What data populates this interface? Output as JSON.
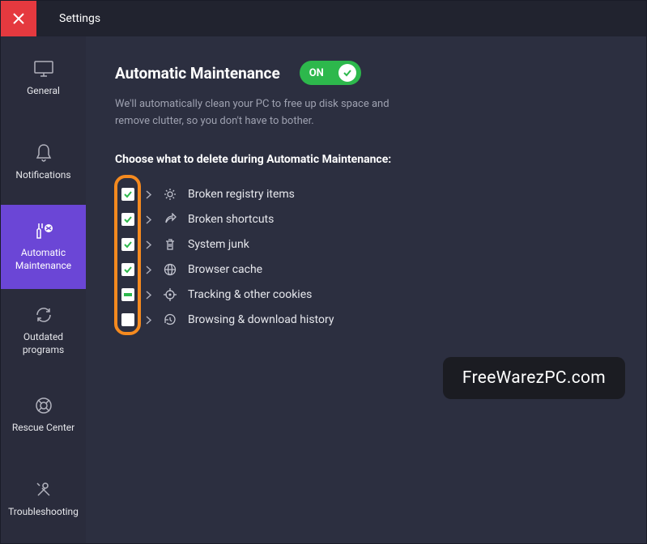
{
  "titlebar": {
    "title": "Settings"
  },
  "sidebar": {
    "items": [
      {
        "label": "General"
      },
      {
        "label": "Notifications"
      },
      {
        "label": "Automatic Maintenance"
      },
      {
        "label": "Outdated programs"
      },
      {
        "label": "Rescue Center"
      },
      {
        "label": "Troubleshooting"
      }
    ]
  },
  "main": {
    "heading": "Automatic Maintenance",
    "toggle_label": "ON",
    "subtext": "We'll automatically clean your PC to free up disk space and remove clutter, so you don't have to bother.",
    "section_head": "Choose what to delete during Automatic Maintenance:",
    "options": [
      {
        "state": "checked",
        "label": "Broken registry items"
      },
      {
        "state": "checked",
        "label": "Broken shortcuts"
      },
      {
        "state": "checked",
        "label": "System junk"
      },
      {
        "state": "checked",
        "label": "Browser cache"
      },
      {
        "state": "partial",
        "label": "Tracking & other cookies"
      },
      {
        "state": "unchecked",
        "label": "Browsing & download history"
      }
    ]
  },
  "watermark": "FreeWarezPC.com"
}
